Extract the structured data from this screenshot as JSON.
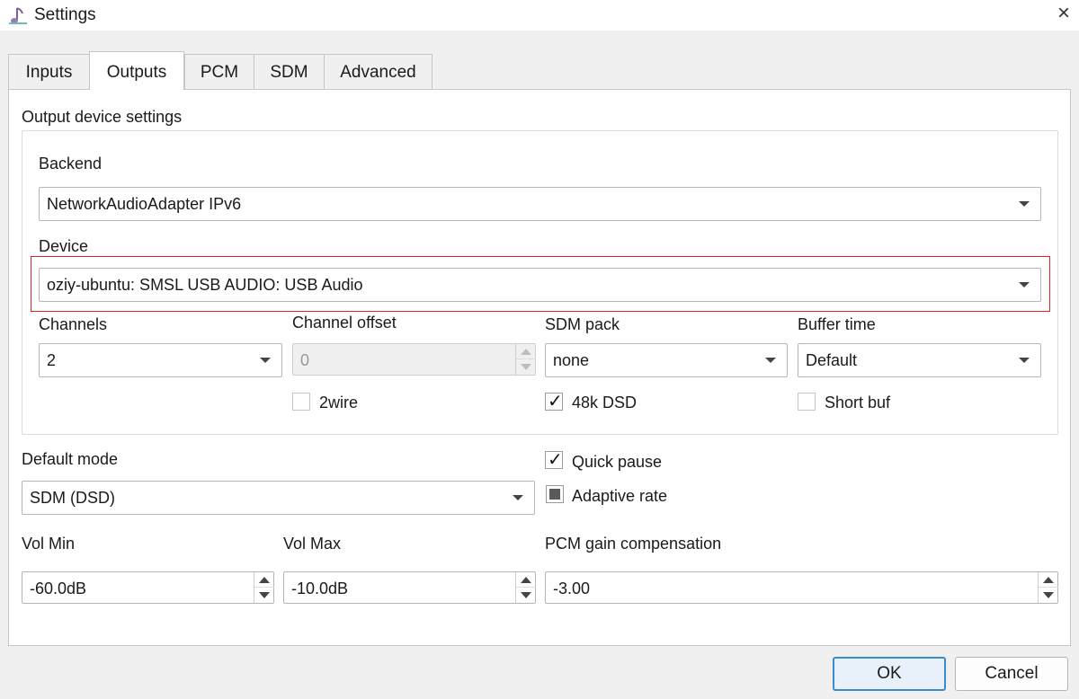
{
  "window": {
    "title": "Settings",
    "icon": "music-note-icon",
    "close": "×"
  },
  "tabs": [
    {
      "label": "Inputs",
      "active": false
    },
    {
      "label": "Outputs",
      "active": true
    },
    {
      "label": "PCM",
      "active": false
    },
    {
      "label": "SDM",
      "active": false
    },
    {
      "label": "Advanced",
      "active": false
    }
  ],
  "output_group": {
    "title": "Output device settings",
    "backend": {
      "label": "Backend",
      "value": "NetworkAudioAdapter IPv6"
    },
    "device": {
      "label": "Device",
      "value": "oziy-ubuntu: SMSL USB AUDIO: USB Audio"
    },
    "channels": {
      "label": "Channels",
      "value": "2"
    },
    "channel_offset": {
      "label": "Channel offset",
      "value": "0"
    },
    "sdm_pack": {
      "label": "SDM pack",
      "value": "none"
    },
    "buffer_time": {
      "label": "Buffer time",
      "value": "Default"
    },
    "twowire": {
      "label": "2wire",
      "checked": false
    },
    "dsd48k": {
      "label": "48k DSD",
      "checked": true
    },
    "short_buf": {
      "label": "Short buf",
      "checked": false
    }
  },
  "default_mode": {
    "label": "Default mode",
    "value": "SDM (DSD)"
  },
  "quick_pause": {
    "label": "Quick pause",
    "checked": true
  },
  "adaptive_rate": {
    "label": "Adaptive rate",
    "checked": "partial"
  },
  "vol_min": {
    "label": "Vol Min",
    "value": "-60.0dB"
  },
  "vol_max": {
    "label": "Vol Max",
    "value": "-10.0dB"
  },
  "pcm_gain": {
    "label": "PCM gain compensation",
    "value": "-3.00"
  },
  "buttons": {
    "ok": "OK",
    "cancel": "Cancel"
  },
  "colors": {
    "highlight": "#d9262c",
    "default_button_border": "#3c8ad0",
    "panel": "#ffffff",
    "window": "#f0f0f0"
  }
}
